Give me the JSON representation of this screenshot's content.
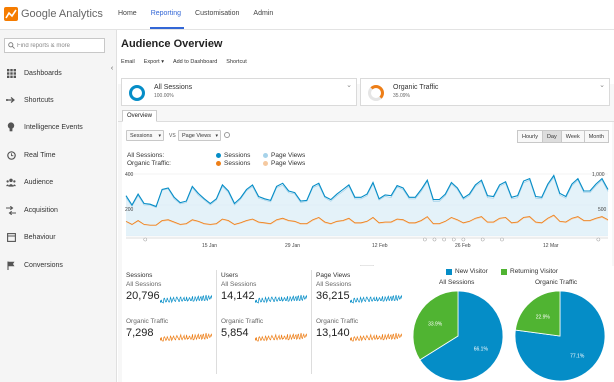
{
  "app": {
    "brand": "Google Analytics",
    "nav": [
      "Home",
      "Reporting",
      "Customisation",
      "Admin"
    ],
    "active_nav": "Reporting"
  },
  "sidebar": {
    "search_placeholder": "Find reports & more",
    "items": [
      {
        "label": "Dashboards",
        "icon": "grid-icon"
      },
      {
        "label": "Shortcuts",
        "icon": "arrow-shortcut-icon"
      },
      {
        "label": "Intelligence Events",
        "icon": "lightbulb-icon"
      },
      {
        "label": "Real Time",
        "icon": "clock-icon"
      },
      {
        "label": "Audience",
        "icon": "people-icon"
      },
      {
        "label": "Acquisition",
        "icon": "acquisition-arrows-icon"
      },
      {
        "label": "Behaviour",
        "icon": "page-icon"
      },
      {
        "label": "Conversions",
        "icon": "flag-icon"
      }
    ]
  },
  "page": {
    "title": "Audience Overview",
    "actions": [
      "Email",
      "Export ▾",
      "Add to Dashboard",
      "Shortcut"
    ]
  },
  "segments": [
    {
      "name": "All Sessions",
      "pct": "100.00%",
      "color": "#058dc7"
    },
    {
      "name": "Organic Traffic",
      "pct": "35.09%",
      "color": "#ed7e17"
    }
  ],
  "tabs": {
    "overview": "Overview"
  },
  "chart_controls": {
    "metric1": "Sessions",
    "vs": "VS",
    "metric2": "Page Views",
    "periods": [
      "Hourly",
      "Day",
      "Week",
      "Month"
    ],
    "active_period": "Day"
  },
  "chart_legend": {
    "row1_label": "All Sessions:",
    "row2_label": "Organic Traffic:",
    "sessions": "Sessions",
    "page_views": "Page Views"
  },
  "colors": {
    "blue": "#058dc7",
    "light_blue": "#a7d3ea",
    "orange": "#ed7e17",
    "light_orange": "#f5c9a0",
    "green": "#50b432"
  },
  "chart_data": {
    "type": "line",
    "x_ticks": [
      "15 Jan",
      "29 Jan",
      "12 Feb",
      "26 Feb",
      "12 Mar"
    ],
    "y_left_ticks": [
      "400",
      "200"
    ],
    "y_right_ticks": [
      "1,000",
      "500"
    ],
    "ylim_left": [
      0,
      400
    ],
    "ylim_right": [
      0,
      1000
    ],
    "series": [
      {
        "name": "Sessions",
        "segment": "All Sessions",
        "axis": "left",
        "values": [
          260,
          200,
          270,
          210,
          205,
          190,
          300,
          310,
          250,
          215,
          225,
          320,
          275,
          240,
          210,
          240,
          330,
          290,
          210,
          245,
          300,
          330,
          255,
          240,
          230,
          320,
          340,
          290,
          280,
          225,
          230,
          320,
          340,
          255,
          235,
          270,
          300,
          330,
          250,
          250,
          270,
          345,
          240,
          265,
          260,
          325,
          310,
          250,
          250,
          300,
          360,
          235,
          235,
          270,
          345,
          310,
          245,
          270,
          330,
          360,
          260,
          255,
          330,
          350,
          250,
          260,
          355,
          370,
          255,
          250,
          335,
          390,
          275,
          255,
          335,
          370,
          290,
          290,
          335,
          370,
          300
        ]
      },
      {
        "name": "Page Views",
        "segment": "All Sessions",
        "axis": "right",
        "values": [
          620,
          480,
          650,
          500,
          500,
          460,
          740,
          760,
          600,
          520,
          540,
          780,
          660,
          580,
          500,
          580,
          800,
          700,
          500,
          590,
          730,
          800,
          610,
          580,
          550,
          780,
          820,
          700,
          680,
          540,
          560,
          780,
          820,
          620,
          560,
          650,
          720,
          800,
          600,
          600,
          650,
          840,
          580,
          640,
          620,
          790,
          750,
          600,
          600,
          720,
          880,
          560,
          560,
          650,
          840,
          750,
          590,
          650,
          800,
          870,
          620,
          610,
          800,
          850,
          600,
          620,
          860,
          900,
          610,
          600,
          810,
          950,
          660,
          610,
          810,
          900,
          700,
          700,
          810,
          900,
          720
        ]
      },
      {
        "name": "Sessions",
        "segment": "Organic Traffic",
        "axis": "left",
        "values": [
          95,
          75,
          100,
          75,
          70,
          70,
          100,
          105,
          90,
          75,
          80,
          105,
          95,
          80,
          75,
          80,
          110,
          100,
          75,
          85,
          100,
          110,
          90,
          85,
          80,
          105,
          115,
          100,
          95,
          80,
          80,
          105,
          120,
          90,
          80,
          95,
          100,
          115,
          85,
          85,
          95,
          120,
          85,
          90,
          90,
          110,
          105,
          85,
          85,
          100,
          125,
          80,
          80,
          95,
          120,
          105,
          85,
          95,
          115,
          125,
          90,
          90,
          115,
          120,
          85,
          90,
          120,
          125,
          90,
          85,
          115,
          135,
          95,
          90,
          115,
          125,
          100,
          100,
          115,
          125,
          105
        ]
      },
      {
        "name": "Page Views",
        "segment": "Organic Traffic",
        "axis": "right",
        "values": [
          230,
          180,
          240,
          180,
          170,
          170,
          240,
          250,
          215,
          180,
          190,
          250,
          230,
          190,
          180,
          190,
          265,
          240,
          180,
          205,
          240,
          265,
          215,
          205,
          190,
          250,
          275,
          240,
          230,
          190,
          190,
          250,
          290,
          215,
          190,
          230,
          240,
          275,
          205,
          205,
          230,
          290,
          205,
          215,
          215,
          265,
          250,
          205,
          205,
          240,
          300,
          190,
          190,
          230,
          290,
          250,
          205,
          230,
          275,
          300,
          215,
          215,
          275,
          290,
          205,
          215,
          290,
          300,
          215,
          205,
          275,
          325,
          230,
          215,
          275,
          300,
          240,
          240,
          275,
          300,
          250
        ]
      }
    ]
  },
  "stats": [
    {
      "header": "Sessions",
      "all_label": "All Sessions",
      "all_value": "20,796",
      "org_label": "Organic Traffic",
      "org_value": "7,298"
    },
    {
      "header": "Users",
      "all_label": "All Sessions",
      "all_value": "14,142",
      "org_label": "Organic Traffic",
      "org_value": "5,854"
    },
    {
      "header": "Page Views",
      "all_label": "All Sessions",
      "all_value": "36,215",
      "org_label": "Organic Traffic",
      "org_value": "13,140"
    }
  ],
  "pies": {
    "legend": [
      "New Visitor",
      "Returning Visitor"
    ],
    "charts": [
      {
        "title": "All Sessions",
        "new_pct": 66.1,
        "returning_pct": 33.9,
        "new_label": "66.1%",
        "returning_label": "33.9%"
      },
      {
        "title": "Organic Traffic",
        "new_pct": 77.1,
        "returning_pct": 22.9,
        "new_label": "77.1%",
        "returning_label": "22.9%"
      }
    ]
  }
}
